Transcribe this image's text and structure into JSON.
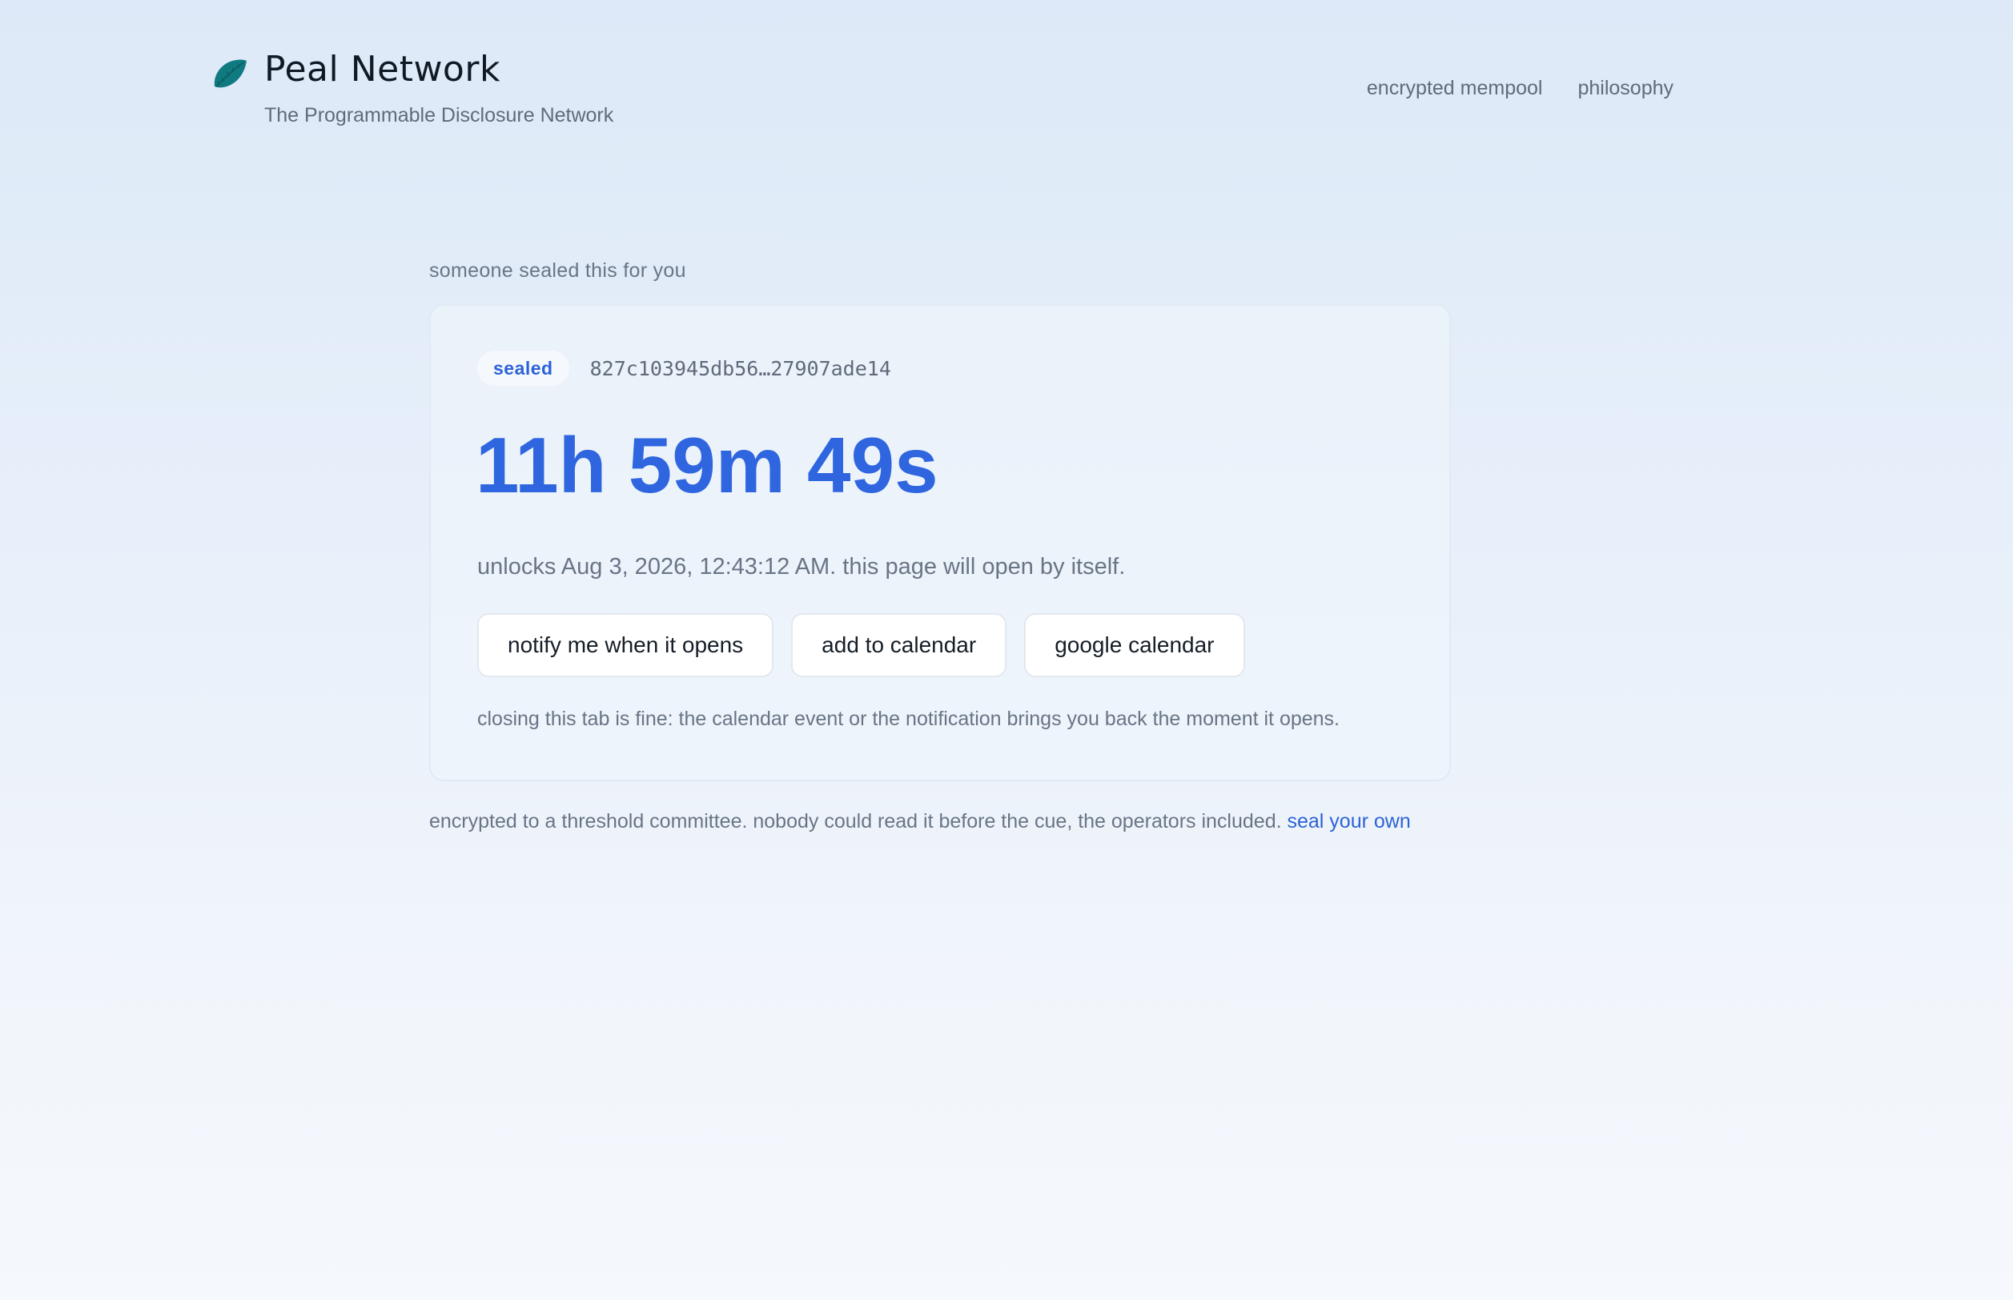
{
  "header": {
    "brand": "Peal Network",
    "tagline": "The Programmable Disclosure Network",
    "logo_icon": "leaf-icon",
    "logo_color": "#0f7a80",
    "nav": [
      {
        "label": "encrypted mempool"
      },
      {
        "label": "philosophy"
      }
    ]
  },
  "main": {
    "eyebrow": "someone sealed this for you",
    "card": {
      "status_badge": "sealed",
      "hash": "827c103945db56…27907ade14",
      "countdown": "11h 59m 49s",
      "unlocks_text": "unlocks Aug 3, 2026, 12:43:12 AM. this page will open by itself.",
      "buttons": [
        {
          "label": "notify me when it opens"
        },
        {
          "label": "add to calendar"
        },
        {
          "label": "google calendar"
        }
      ],
      "hint": "closing this tab is fine: the calendar event or the notification brings you back the moment it opens."
    },
    "footer_note": "encrypted to a threshold committee. nobody could read it before the cue, the operators included.",
    "footer_link": "seal your own"
  },
  "colors": {
    "accent": "#2f66e0",
    "link": "#2b62d6",
    "muted_text": "#687585"
  }
}
